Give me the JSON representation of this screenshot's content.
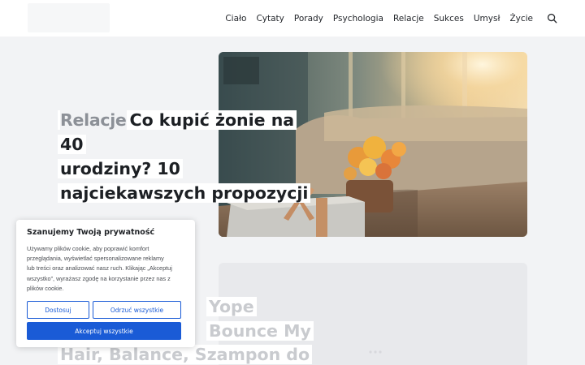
{
  "nav": {
    "items": [
      "Ciało",
      "Cytaty",
      "Porady",
      "Psychologia",
      "Relacje",
      "Sukces",
      "Umysł",
      "Życie"
    ]
  },
  "posts": [
    {
      "category": "Relacje",
      "title_lines": [
        "Co kupić żonie na 40",
        "urodziny? 10",
        "najciekawszych propozycji"
      ]
    },
    {
      "title_lines": [
        "Yope",
        "Bounce My",
        "Hair, Balance, Szampon do"
      ]
    }
  ],
  "cookie": {
    "title": "Szanujemy Twoją prywatność",
    "text_lines": [
      "Używamy plików cookie, aby poprawić komfort",
      "przeglądania, wyświetlać spersonalizowane reklamy",
      "lub treści oraz analizować nasz ruch. Klikając „Akceptuj",
      "wszystko”, wyrażasz zgodę na korzystanie przez nas z",
      "plików cookie."
    ],
    "customize_label": "Dostosuj",
    "reject_label": "Odrzuć wszystkie",
    "accept_label": "Akceptuj wszystkie"
  },
  "colors": {
    "accent": "#1a5bd6",
    "page_bg": "#f2f3f5",
    "text": "#1d2024",
    "category": "#8c9097"
  }
}
